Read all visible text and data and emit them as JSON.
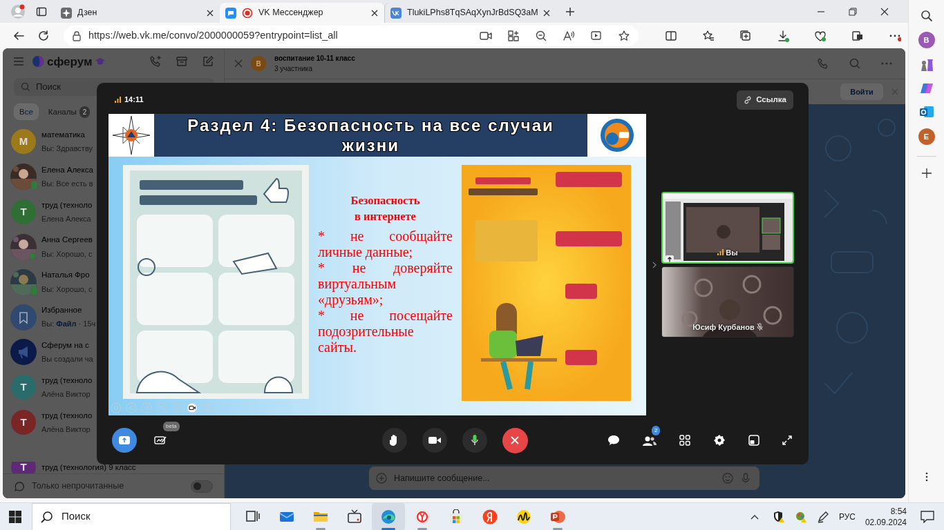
{
  "browser": {
    "tabs": [
      {
        "title": "Дзен",
        "selected": false,
        "kind": "star"
      },
      {
        "title": "VK Мессенджер",
        "selected": true,
        "kind": "recording"
      },
      {
        "title": "TlukiLPhs8TqSAqXynJrBdSQ3aM",
        "selected": false,
        "kind": "vk"
      }
    ],
    "url": "https://web.vk.me/convo/2000000059?entrypoint=list_all"
  },
  "edge_sidebar": {
    "avatars": [
      {
        "letter": "B",
        "color": "#9b59b6"
      },
      {
        "letter": "E",
        "color": "#c0622a"
      }
    ]
  },
  "messenger": {
    "brand": "сферум",
    "search": {
      "placeholder": "Поиск"
    },
    "filters": [
      {
        "label": "Все",
        "selected": true
      },
      {
        "label": "Каналы",
        "count": "2",
        "selected": false
      }
    ],
    "chats": [
      {
        "kind": "letter",
        "avatar": "М",
        "color": "#9c7a1c",
        "online": false,
        "name": "математика",
        "preview": "Вы: Здравству"
      },
      {
        "online": true,
        "mobile": true,
        "name": "Елена Алекса",
        "preview": "Вы: Все есть в"
      },
      {
        "kind": "letter",
        "avatar": "Т",
        "color": "#2f6e35",
        "online": false,
        "name": "труд (техноло",
        "preview": "Елена Алекса"
      },
      {
        "online": true,
        "mobile": false,
        "name": "Анна Сергеев",
        "preview": "Вы: Хорошо, с"
      },
      {
        "online": true,
        "mobile": true,
        "name": "Наталья Фро",
        "preview": "Вы: Хорошо, с"
      },
      {
        "kind": "bookmark",
        "online": false,
        "name": "Избранное",
        "preview": "Вы:",
        "attachment": "Файл",
        "time": "· 15ч"
      },
      {
        "kind": "megaphone",
        "online": false,
        "name": "Сферум на с",
        "preview": "Вы создали ча"
      },
      {
        "kind": "letter",
        "avatar": "Т",
        "color": "#2a6b6b",
        "online": false,
        "name": "труд (техноло",
        "preview": "Алёна Виктор"
      },
      {
        "kind": "letter",
        "avatar": "Т",
        "color": "#7a2626",
        "online": false,
        "name": "труд (техноло",
        "preview": "Алёна Виктор"
      },
      {
        "kind": "letter",
        "avatar": "Т",
        "color": "#5e2a78",
        "online": false,
        "name": "труд (технология) 9 класс"
      }
    ],
    "unread_only": {
      "label": "Только непрочитанные",
      "on": false
    }
  },
  "chat": {
    "avatar": "В",
    "title": "воспитание 10-11 класс",
    "subtitle": "3 участника",
    "join_button": "Войти",
    "composer": {
      "placeholder": "Напишите сообщение..."
    }
  },
  "call": {
    "time": "14:11",
    "link_button": "Ссылка",
    "slide": {
      "title": "Раздел 4: Безопасность на все случаи жизни",
      "heading_lines": [
        "Безопасность",
        "в интернете"
      ],
      "bullets": [
        "* не сообщайте личные данные;",
        "* не доверяйте виртуальным «друзьям»;",
        "* не посещайте подозрительные сайты."
      ]
    },
    "participants": [
      {
        "name": "Вы",
        "kind": "self",
        "selected": true,
        "muted": false
      },
      {
        "name": "Юсиф Курбанов",
        "kind": "remote",
        "selected": false,
        "muted": true
      }
    ],
    "whiteboard_badge": "beta",
    "mic_on": true,
    "camera_on": false,
    "participants_count": "2"
  },
  "taskbar": {
    "search": "Поиск",
    "apps": [
      {
        "kind": "taskview",
        "running": false
      },
      {
        "kind": "mail",
        "running": false
      },
      {
        "kind": "folder",
        "running": true
      },
      {
        "kind": "media",
        "running": false
      },
      {
        "kind": "edge",
        "running": true,
        "selected": true
      },
      {
        "kind": "ybrowser",
        "running": true
      },
      {
        "kind": "store",
        "running": false
      },
      {
        "kind": "yandex",
        "running": false
      },
      {
        "kind": "music",
        "running": false
      },
      {
        "kind": "ppt",
        "running": true
      }
    ],
    "language": "РУС",
    "time": "8:54",
    "date": "02.09.2024"
  }
}
